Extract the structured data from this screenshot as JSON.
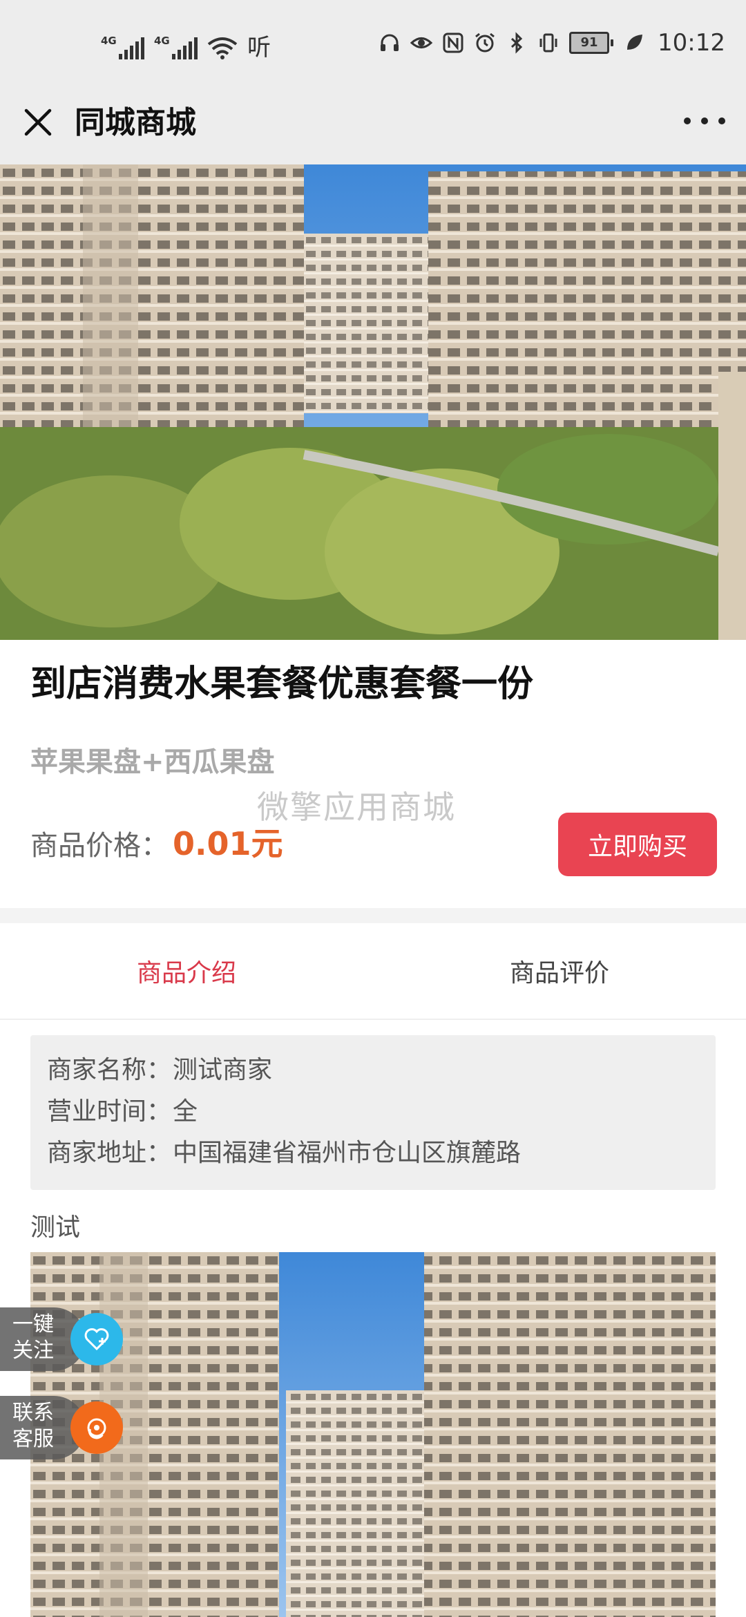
{
  "status_bar": {
    "network1": "4G",
    "network2": "4G",
    "hd_label": "听",
    "battery_level": "91",
    "time": "10:12"
  },
  "nav": {
    "title": "同城商城"
  },
  "product": {
    "title": "到店消费水果套餐优惠套餐一份",
    "subtitle": "苹果果盘+西瓜果盘",
    "watermark": "微擎应用商城",
    "price_label": "商品价格：",
    "price_value": "0.01元",
    "buy_label": "立即购买"
  },
  "tabs": [
    {
      "label": "商品介绍",
      "active": true
    },
    {
      "label": "商品评价",
      "active": false
    }
  ],
  "merchant": {
    "name_key": "商家名称：",
    "name_value": "测试商家",
    "hours_key": "营业时间：",
    "hours_value": "全",
    "address_key": "商家地址：",
    "address_value": "中国福建省福州市仓山区旗麓路"
  },
  "description": "测试",
  "floating": {
    "follow_label": "一键关注",
    "service_label": "联系客服"
  },
  "colors": {
    "accent_red": "#e94452",
    "price_orange": "#e5632a",
    "follow_blue": "#2cb8ea",
    "service_orange": "#f26a1b"
  }
}
